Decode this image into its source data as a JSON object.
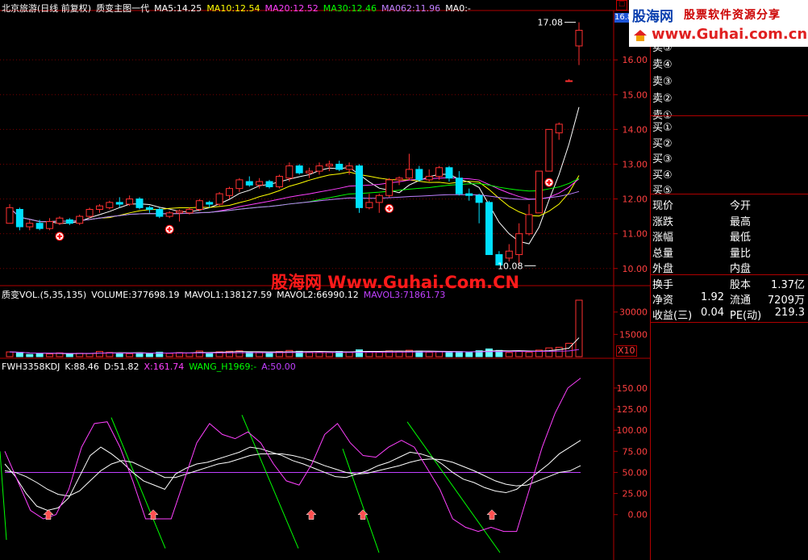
{
  "header": {
    "title": "北京旅游(日线 前复权)",
    "indicator": "质变主图一代",
    "ma": [
      {
        "label": "MA5:14.25",
        "color": "#ffffff"
      },
      {
        "label": "MA10:12.54",
        "color": "#ffff00"
      },
      {
        "label": "MA20:12.52",
        "color": "#ff40ff"
      },
      {
        "label": "MA30:12.46",
        "color": "#00ff00"
      },
      {
        "label": "MA062:11.96",
        "color": "#c080ff"
      },
      {
        "label": "MA0:-",
        "color": "#ffffff"
      }
    ]
  },
  "vol_header": {
    "name": "质变VOL.(5,35,135)",
    "items": [
      {
        "label": "VOLUME:377698.19",
        "color": "#ffffff"
      },
      {
        "label": "MAVOL1:138127.59",
        "color": "#ffffff"
      },
      {
        "label": "MAVOL2:66990.12",
        "color": "#ffffff"
      },
      {
        "label": "MAVOL3:71861.73",
        "color": "#c040ff"
      }
    ]
  },
  "kdj_header": {
    "name": "FWH3358KDJ",
    "items": [
      {
        "label": "K:88.46",
        "color": "#ffffff"
      },
      {
        "label": "D:51.82",
        "color": "#ffffff"
      },
      {
        "label": "X:161.74",
        "color": "#ff40ff"
      },
      {
        "label": "WANG_H1969:-",
        "color": "#00ff00"
      },
      {
        "label": "A:50.00",
        "color": "#c040ff"
      }
    ]
  },
  "watermark": "股海网 Www.Guhai.Com.CN",
  "banner": {
    "logo": "股海网",
    "slogan": "股票软件资源分享",
    "url": "www.Guhai.com.cn"
  },
  "top_tag": "16.8",
  "x10_label": "X10",
  "side_panel": {
    "asks": [
      "卖⑤",
      "卖④",
      "卖③",
      "卖②",
      "卖①"
    ],
    "bids": [
      "买①",
      "买②",
      "买③",
      "买④",
      "买⑤"
    ],
    "stats": [
      {
        "left": "现价",
        "right": "今开"
      },
      {
        "left": "涨跌",
        "right": "最高"
      },
      {
        "left": "涨幅",
        "right": "最低"
      },
      {
        "left": "总量",
        "right": "量比"
      },
      {
        "left": "外盘",
        "right": "内盘"
      }
    ],
    "fundamentals": [
      {
        "l1": "换手",
        "v1": "",
        "l2": "股本",
        "v2": "1.37亿"
      },
      {
        "l1": "净资",
        "v1": "1.92",
        "l2": "流通",
        "v2": "7209万"
      },
      {
        "l1": "收益(三)",
        "v1": "0.04",
        "l2": "PE(动)",
        "v2": "219.3"
      }
    ]
  },
  "chart_data": [
    {
      "type": "candlestick",
      "title": "北京旅游(日线 前复权)",
      "yticks": [
        10.0,
        11.0,
        12.0,
        13.0,
        14.0,
        15.0,
        16.0
      ],
      "ylim": [
        9.6,
        17.35
      ],
      "annotations": [
        {
          "text": "17.08",
          "x_index": 62,
          "y": 17.08
        },
        {
          "text": "10.08",
          "x_index": 53,
          "y": 10.08
        }
      ],
      "signal_up_markers_x_index": [
        5,
        16,
        38,
        54
      ],
      "candles": [
        {
          "o": 11.3,
          "h": 11.85,
          "l": 11.3,
          "c": 11.75
        },
        {
          "o": 11.7,
          "h": 11.75,
          "l": 11.1,
          "c": 11.2
        },
        {
          "o": 11.2,
          "h": 11.4,
          "l": 11.1,
          "c": 11.3
        },
        {
          "o": 11.3,
          "h": 11.4,
          "l": 11.1,
          "c": 11.15
        },
        {
          "o": 11.15,
          "h": 11.45,
          "l": 11.1,
          "c": 11.35
        },
        {
          "o": 11.3,
          "h": 11.5,
          "l": 11.25,
          "c": 11.45
        },
        {
          "o": 11.4,
          "h": 11.45,
          "l": 11.25,
          "c": 11.3
        },
        {
          "o": 11.3,
          "h": 11.55,
          "l": 11.25,
          "c": 11.5
        },
        {
          "o": 11.5,
          "h": 11.75,
          "l": 11.45,
          "c": 11.7
        },
        {
          "o": 11.7,
          "h": 11.85,
          "l": 11.6,
          "c": 11.8
        },
        {
          "o": 11.75,
          "h": 11.95,
          "l": 11.7,
          "c": 11.9
        },
        {
          "o": 11.9,
          "h": 12.05,
          "l": 11.75,
          "c": 11.85
        },
        {
          "o": 11.85,
          "h": 12.1,
          "l": 11.8,
          "c": 12.0
        },
        {
          "o": 12.0,
          "h": 12.05,
          "l": 11.7,
          "c": 11.75
        },
        {
          "o": 11.75,
          "h": 11.8,
          "l": 11.6,
          "c": 11.7
        },
        {
          "o": 11.7,
          "h": 11.75,
          "l": 11.45,
          "c": 11.5
        },
        {
          "o": 11.5,
          "h": 11.65,
          "l": 11.45,
          "c": 11.6
        },
        {
          "o": 11.6,
          "h": 11.7,
          "l": 11.35,
          "c": 11.65
        },
        {
          "o": 11.6,
          "h": 11.75,
          "l": 11.55,
          "c": 11.7
        },
        {
          "o": 11.7,
          "h": 12.0,
          "l": 11.65,
          "c": 11.95
        },
        {
          "o": 11.9,
          "h": 11.95,
          "l": 11.75,
          "c": 11.85
        },
        {
          "o": 11.85,
          "h": 12.2,
          "l": 11.8,
          "c": 12.15
        },
        {
          "o": 12.1,
          "h": 12.35,
          "l": 12.0,
          "c": 12.3
        },
        {
          "o": 12.3,
          "h": 12.6,
          "l": 12.2,
          "c": 12.55
        },
        {
          "o": 12.5,
          "h": 12.65,
          "l": 12.35,
          "c": 12.4
        },
        {
          "o": 12.4,
          "h": 12.6,
          "l": 12.3,
          "c": 12.5
        },
        {
          "o": 12.5,
          "h": 12.55,
          "l": 12.3,
          "c": 12.35
        },
        {
          "o": 12.35,
          "h": 12.7,
          "l": 12.3,
          "c": 12.65
        },
        {
          "o": 12.6,
          "h": 13.05,
          "l": 12.5,
          "c": 12.95
        },
        {
          "o": 12.95,
          "h": 13.0,
          "l": 12.7,
          "c": 12.75
        },
        {
          "o": 12.75,
          "h": 12.9,
          "l": 12.6,
          "c": 12.8
        },
        {
          "o": 12.8,
          "h": 13.05,
          "l": 12.7,
          "c": 12.95
        },
        {
          "o": 12.95,
          "h": 13.1,
          "l": 12.8,
          "c": 13.0
        },
        {
          "o": 13.0,
          "h": 13.1,
          "l": 12.8,
          "c": 12.85
        },
        {
          "o": 12.85,
          "h": 13.05,
          "l": 12.7,
          "c": 12.95
        },
        {
          "o": 12.95,
          "h": 13.0,
          "l": 11.6,
          "c": 11.75
        },
        {
          "o": 11.75,
          "h": 12.15,
          "l": 11.7,
          "c": 11.9
        },
        {
          "o": 11.9,
          "h": 12.15,
          "l": 11.6,
          "c": 12.1
        },
        {
          "o": 12.1,
          "h": 12.6,
          "l": 12.05,
          "c": 12.55
        },
        {
          "o": 12.55,
          "h": 12.65,
          "l": 12.4,
          "c": 12.6
        },
        {
          "o": 12.6,
          "h": 13.3,
          "l": 12.55,
          "c": 12.85
        },
        {
          "o": 12.85,
          "h": 12.95,
          "l": 12.5,
          "c": 12.55
        },
        {
          "o": 12.55,
          "h": 12.85,
          "l": 12.5,
          "c": 12.65
        },
        {
          "o": 12.65,
          "h": 12.95,
          "l": 12.55,
          "c": 12.9
        },
        {
          "o": 12.9,
          "h": 12.95,
          "l": 12.5,
          "c": 12.6
        },
        {
          "o": 12.6,
          "h": 12.8,
          "l": 12.1,
          "c": 12.15
        },
        {
          "o": 12.15,
          "h": 12.3,
          "l": 11.95,
          "c": 12.1
        },
        {
          "o": 12.1,
          "h": 12.15,
          "l": 11.3,
          "c": 11.9
        },
        {
          "o": 11.9,
          "h": 11.95,
          "l": 10.4,
          "c": 10.4
        },
        {
          "o": 10.4,
          "h": 10.5,
          "l": 10.1,
          "c": 10.1
        },
        {
          "o": 10.3,
          "h": 10.7,
          "l": 10.2,
          "c": 10.5
        },
        {
          "o": 10.4,
          "h": 11.3,
          "l": 10.1,
          "c": 11.0
        },
        {
          "o": 11.0,
          "h": 11.85,
          "l": 10.95,
          "c": 11.55
        },
        {
          "o": 11.6,
          "h": 12.8,
          "l": 11.6,
          "c": 12.8
        },
        {
          "o": 12.8,
          "h": 14.0,
          "l": 12.8,
          "c": 14.0
        },
        {
          "o": 13.9,
          "h": 14.2,
          "l": 13.7,
          "c": 14.15
        },
        {
          "o": 15.4,
          "h": 15.45,
          "l": 15.4,
          "c": 15.4
        },
        {
          "o": 16.4,
          "h": 17.08,
          "l": 15.85,
          "c": 16.85
        }
      ]
    },
    {
      "type": "bar",
      "title": "质变VOL.(5,35,135)",
      "yticks": [
        15000,
        30000
      ],
      "unit_label": "X10",
      "values": [
        3200,
        2800,
        1500,
        2200,
        1800,
        2600,
        1700,
        2300,
        2100,
        3500,
        2800,
        2400,
        2000,
        2600,
        2300,
        3000,
        2200,
        2700,
        2500,
        3800,
        2700,
        3300,
        3600,
        3900,
        3100,
        2800,
        2600,
        3500,
        4200,
        3600,
        3100,
        3300,
        2800,
        3500,
        3200,
        4600,
        3400,
        3100,
        3900,
        3600,
        4300,
        3700,
        3000,
        3500,
        3200,
        3400,
        3100,
        4000,
        5200,
        4200,
        2800,
        3800,
        3100,
        4400,
        5900,
        6300,
        9000,
        38000
      ],
      "up": [
        1,
        0,
        0,
        0,
        1,
        1,
        0,
        1,
        1,
        1,
        1,
        0,
        1,
        0,
        0,
        0,
        1,
        1,
        1,
        1,
        0,
        1,
        1,
        1,
        0,
        1,
        0,
        1,
        1,
        0,
        1,
        1,
        1,
        0,
        1,
        0,
        1,
        1,
        1,
        1,
        1,
        0,
        1,
        1,
        0,
        0,
        0,
        0,
        0,
        0,
        1,
        1,
        1,
        1,
        1,
        1,
        1,
        1
      ]
    },
    {
      "type": "line",
      "title": "FWH3358KDJ",
      "yticks": [
        0.0,
        25.0,
        50.0,
        75.0,
        100.0,
        125.0,
        150.0
      ],
      "ylim": [
        -50,
        170
      ],
      "series": [
        {
          "name": "K",
          "color": "#ffffff",
          "values": [
            60,
            45,
            25,
            10,
            5,
            8,
            20,
            45,
            70,
            80,
            72,
            62,
            50,
            40,
            35,
            30,
            48,
            55,
            60,
            62,
            66,
            70,
            74,
            80,
            78,
            74,
            70,
            64,
            60,
            55,
            50,
            45,
            44,
            48,
            52,
            58,
            62,
            68,
            74,
            72,
            68,
            60,
            50,
            42,
            38,
            32,
            28,
            26,
            30,
            40,
            50,
            60,
            72,
            80,
            88
          ]
        },
        {
          "name": "D",
          "color": "#ffffff",
          "values": [
            52,
            50,
            45,
            38,
            30,
            24,
            22,
            28,
            40,
            52,
            60,
            64,
            62,
            56,
            50,
            44,
            44,
            48,
            52,
            56,
            60,
            62,
            66,
            70,
            72,
            72,
            72,
            70,
            67,
            63,
            58,
            54,
            50,
            48,
            49,
            52,
            55,
            58,
            62,
            65,
            66,
            65,
            62,
            57,
            52,
            46,
            40,
            36,
            34,
            35,
            40,
            45,
            50,
            51.82,
            58
          ]
        },
        {
          "name": "X",
          "color": "#ff40ff",
          "values": [
            75,
            40,
            5,
            -5,
            0,
            30,
            80,
            108,
            110,
            80,
            40,
            -5,
            -5,
            -5,
            40,
            85,
            108,
            95,
            90,
            98,
            85,
            60,
            40,
            35,
            60,
            95,
            108,
            85,
            70,
            68,
            80,
            88,
            80,
            55,
            30,
            -5,
            -15,
            -20,
            -15,
            -20,
            -20,
            30,
            80,
            120,
            150,
            161.74
          ]
        },
        {
          "name": "A",
          "color": "#c040ff",
          "values": [
            50,
            50
          ]
        }
      ],
      "signal_up_markers_x_index": [
        3,
        11,
        22,
        27,
        38
      ]
    }
  ]
}
